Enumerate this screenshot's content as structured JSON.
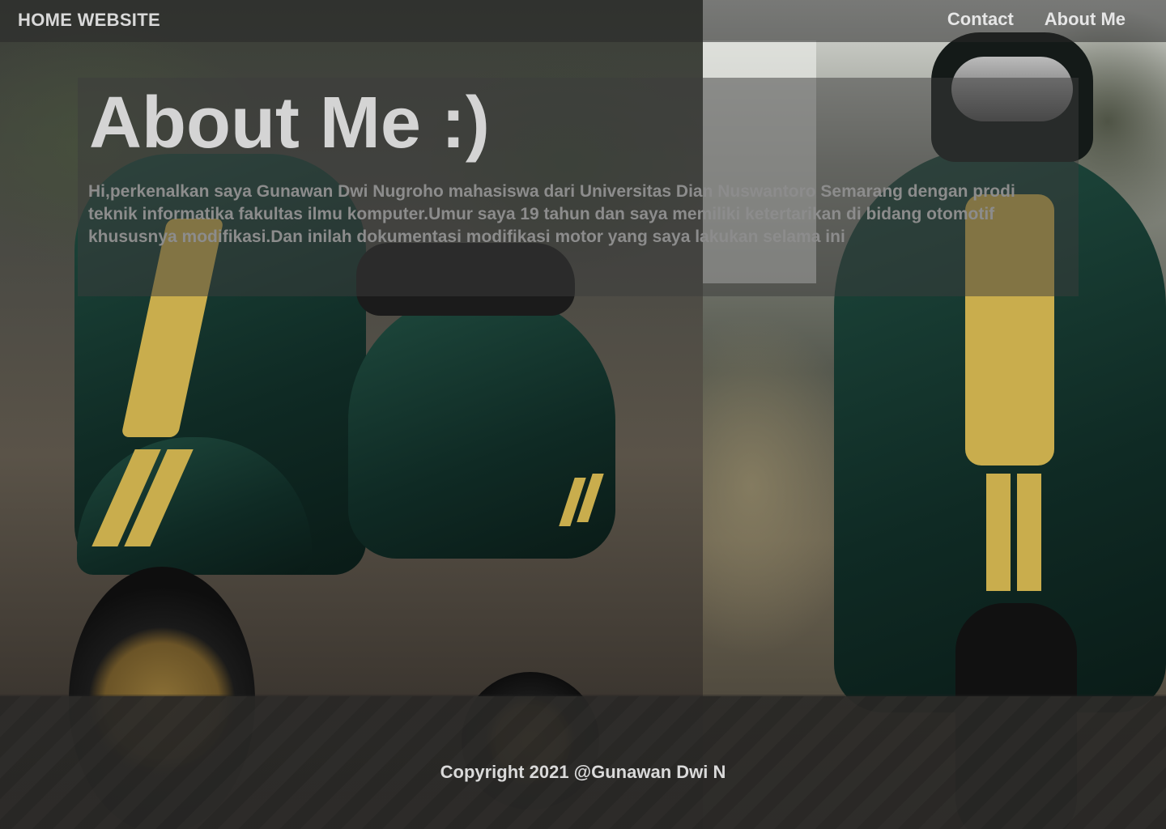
{
  "nav": {
    "brand": "HOME WEBSITE",
    "links": [
      {
        "label": "Contact"
      },
      {
        "label": "About Me"
      }
    ]
  },
  "about": {
    "title": "About Me :)",
    "paragraph": "Hi,perkenalkan saya Gunawan Dwi Nugroho mahasiswa dari Universitas Dian Nuswantoro Semarang dengan prodi teknik informatika fakultas ilmu komputer.Umur saya 19 tahun dan saya memiliki ketertarikan di bidang otomotif khususnya modifikasi.Dan inilah dokumentasi modifikasi motor yang saya lakukan selama ini"
  },
  "footer": {
    "copyright": "Copyright 2021 @Gunawan Dwi N"
  },
  "colors": {
    "nav_text": "#e6e6e6",
    "title_text": "#d4d4d4",
    "body_text": "#8c8c8c",
    "scooter_green": "#1f4a3e",
    "scooter_stripe": "#c9ad4d"
  }
}
